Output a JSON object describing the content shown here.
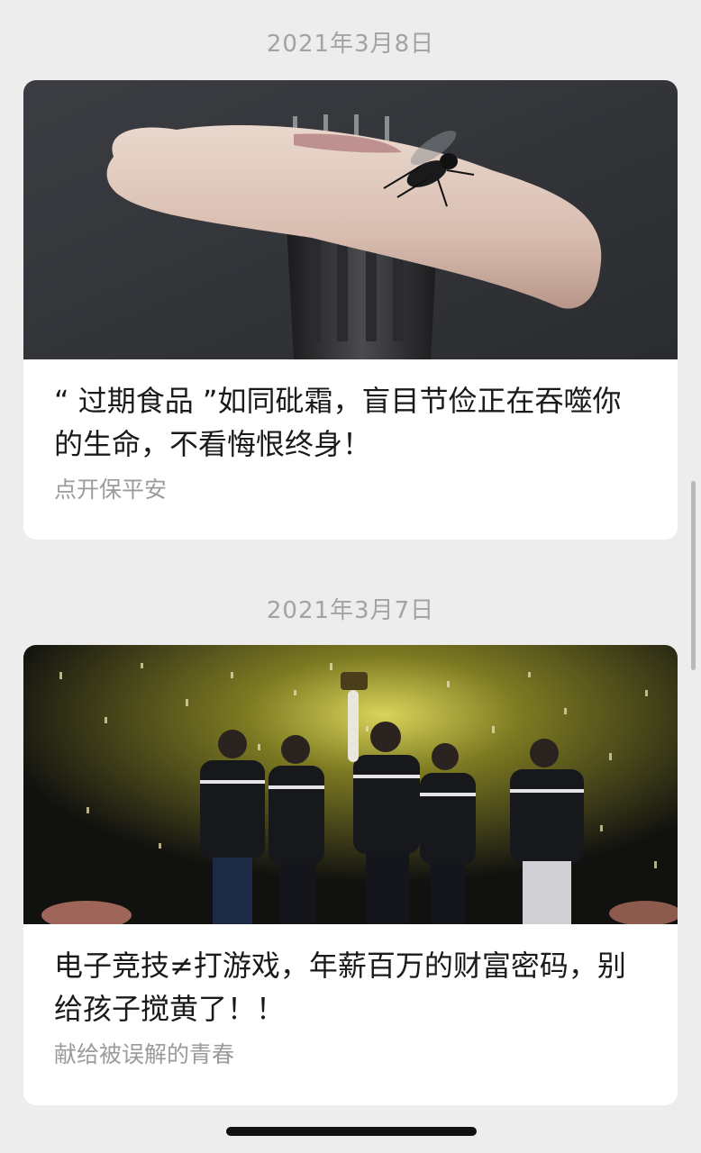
{
  "feed": {
    "articles": [
      {
        "date": "2021年3月8日",
        "title": "“ 过期食品 ”如同砒霜，盲目节俭正在吞噬你的生命，不看悔恨终身！",
        "digest": "点开保平安",
        "cover_description": "fly-on-meat-fork-image"
      },
      {
        "date": "2021年3月7日",
        "title": "电子竞技≠打游戏，年薪百万的财富密码，别给孩子搅黄了！！",
        "digest": "献给被误解的青春",
        "cover_description": "esports-team-celebration-image"
      }
    ]
  },
  "colors": {
    "background": "#ededed",
    "card": "#ffffff",
    "date_text": "#a3a3a3",
    "title_text": "#1a1a1a",
    "digest_text": "#9b9b9b"
  }
}
